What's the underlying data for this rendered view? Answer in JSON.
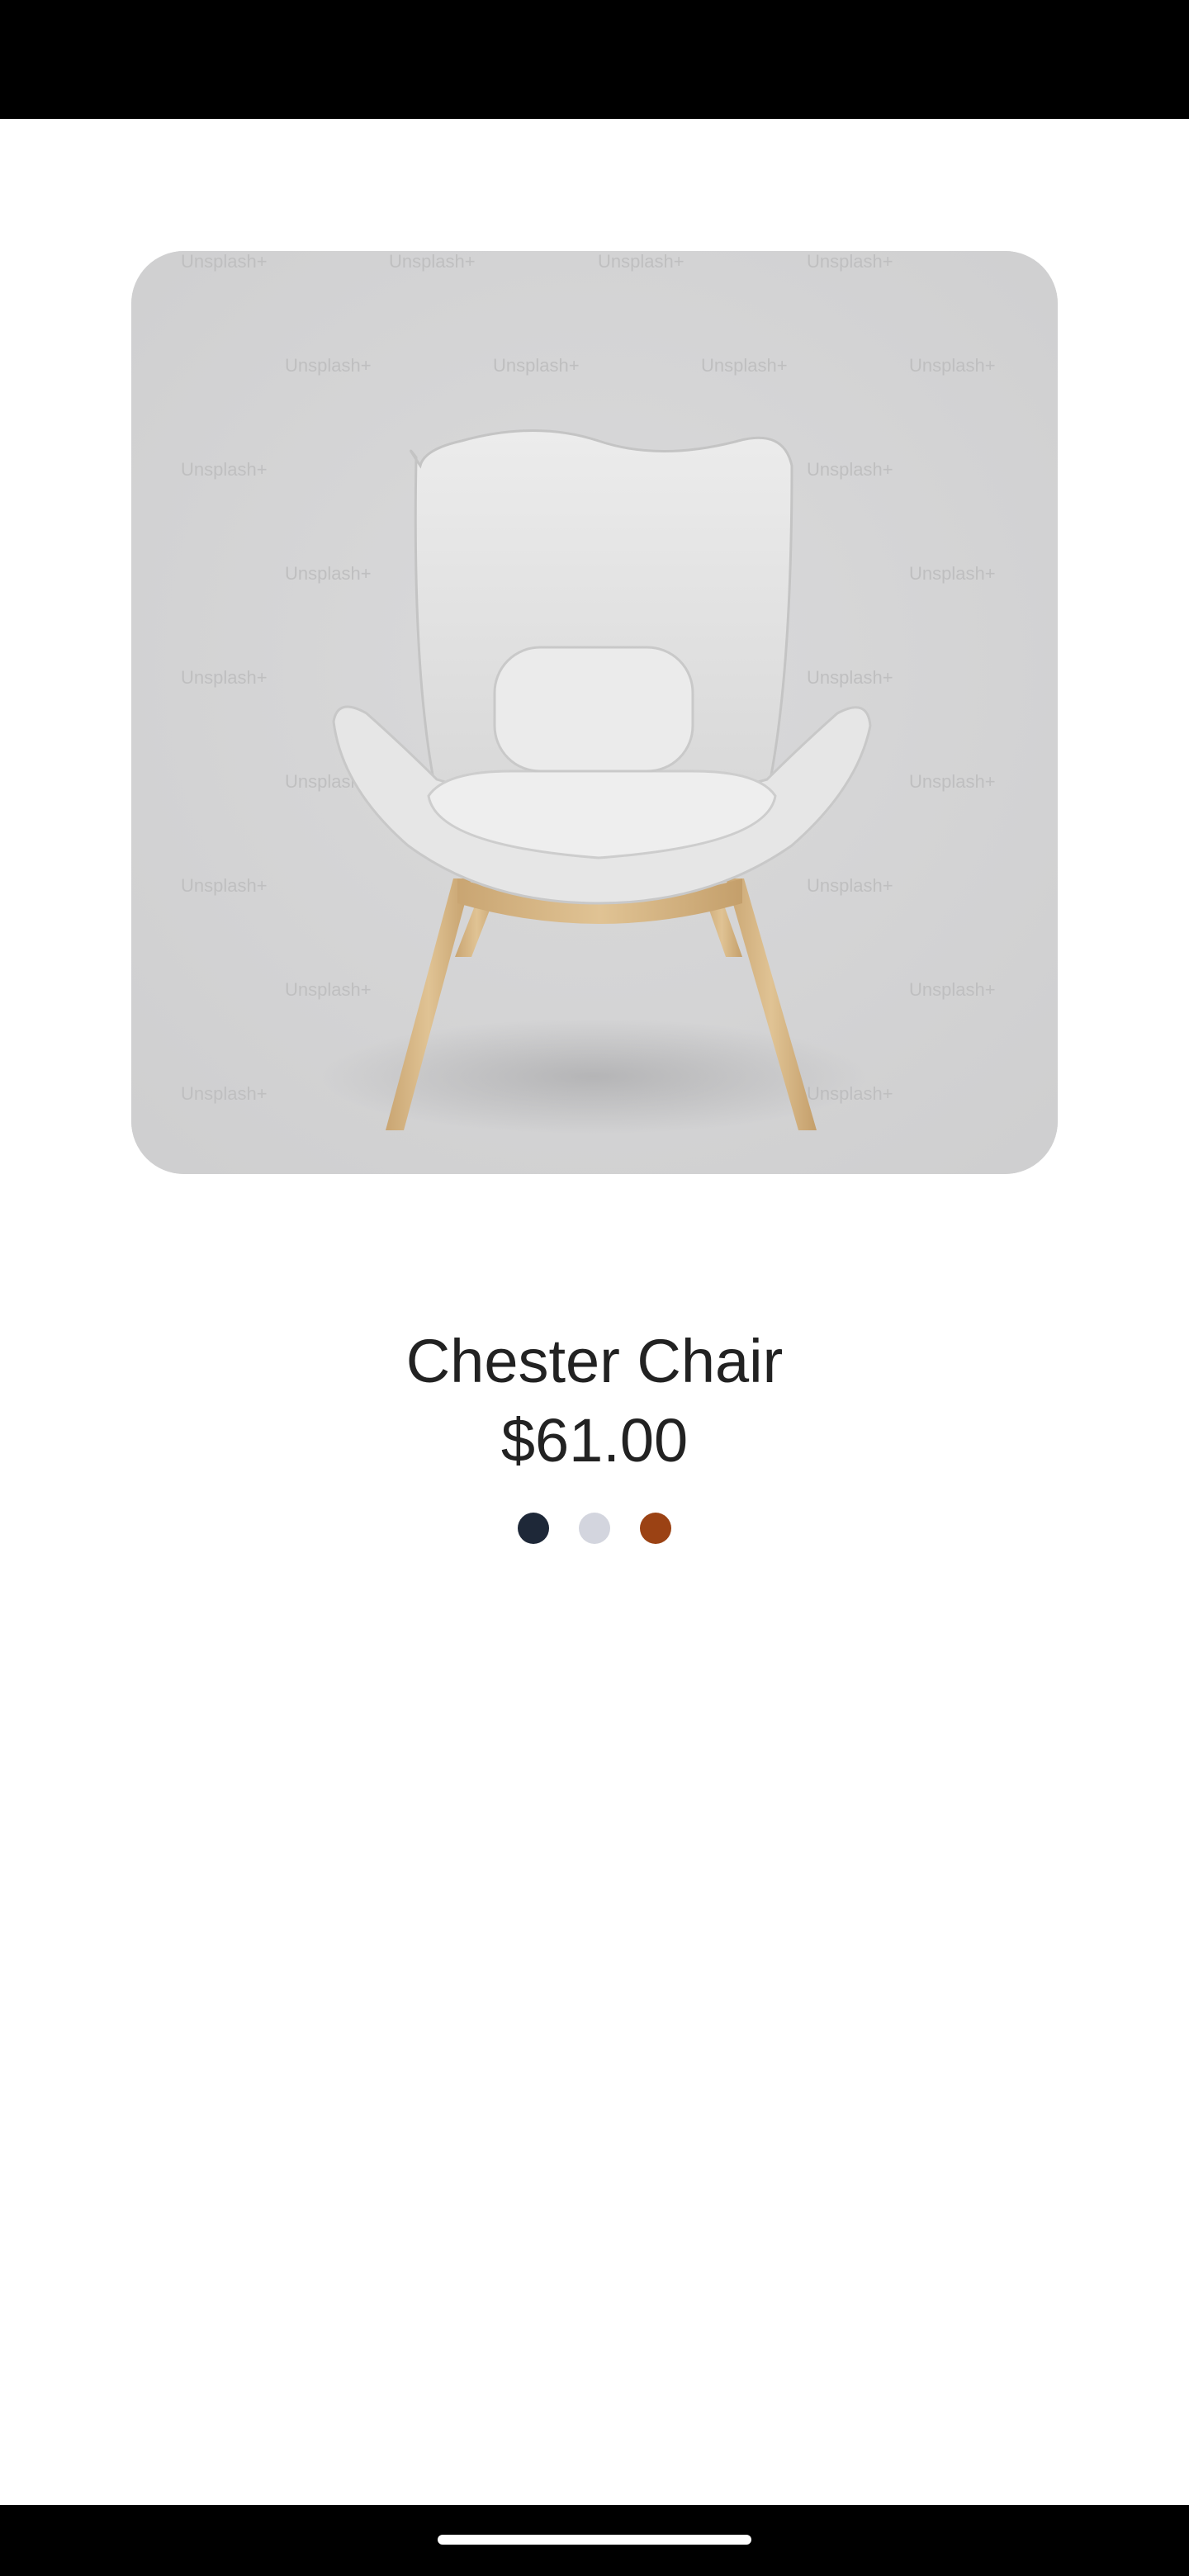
{
  "product": {
    "name": "Chester Chair",
    "price": "$61.00",
    "image_watermark": "Unsplash+",
    "colors": [
      {
        "name": "navy",
        "hex": "#1e2838"
      },
      {
        "name": "light-gray",
        "hex": "#d3d5de"
      },
      {
        "name": "rust",
        "hex": "#9b4214"
      }
    ]
  },
  "theme": {
    "image_background": "#d2d2d3",
    "text_color": "#222222"
  }
}
